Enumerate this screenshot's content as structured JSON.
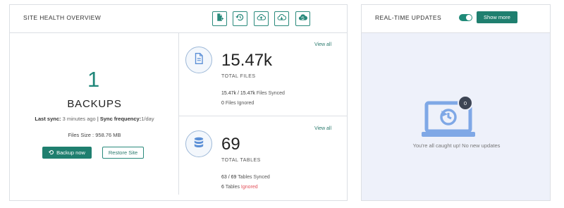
{
  "health": {
    "title": "SITE HEALTH OVERVIEW",
    "toolbar": [
      {
        "icon": "file-add-icon"
      },
      {
        "icon": "history-icon"
      },
      {
        "icon": "cloud-upload-icon"
      },
      {
        "icon": "cloud-download-icon"
      },
      {
        "icon": "cloud-sync-icon"
      }
    ],
    "backups": {
      "count": "1",
      "label": "BACKUPS",
      "last_sync_label": "Last sync:",
      "last_sync_value": "3 minutes ago",
      "separator": "|",
      "frequency_label": "Sync frequency:",
      "frequency_value": "1/day",
      "size_label": "Files Size :",
      "size_value": "958.76 MB",
      "backup_now": "Backup now",
      "restore": "Restore Site"
    },
    "files": {
      "value": "15.47k",
      "label": "TOTAL FILES",
      "synced_count": "15.47k / 15.47k",
      "synced_text": "Files Synced",
      "ignored_count": "0",
      "ignored_text": "Files Ignored",
      "view_all": "View all"
    },
    "tables": {
      "value": "69",
      "label": "TOTAL TABLES",
      "synced_count": "63 / 69",
      "synced_text": "Tables Synced",
      "ignored_count": "6",
      "ignored_prefix": "Tables",
      "ignored_text": "Ignored",
      "view_all": "View all"
    }
  },
  "realtime": {
    "title": "REAL-TIME UPDATES",
    "toggle_on": true,
    "show_more": "Show more",
    "badge_count": "0",
    "empty_message": "You're all caught up! No new updates"
  },
  "colors": {
    "accent": "#1f7f6f",
    "danger": "#e2505a",
    "illustration": "#7fa8e6"
  }
}
